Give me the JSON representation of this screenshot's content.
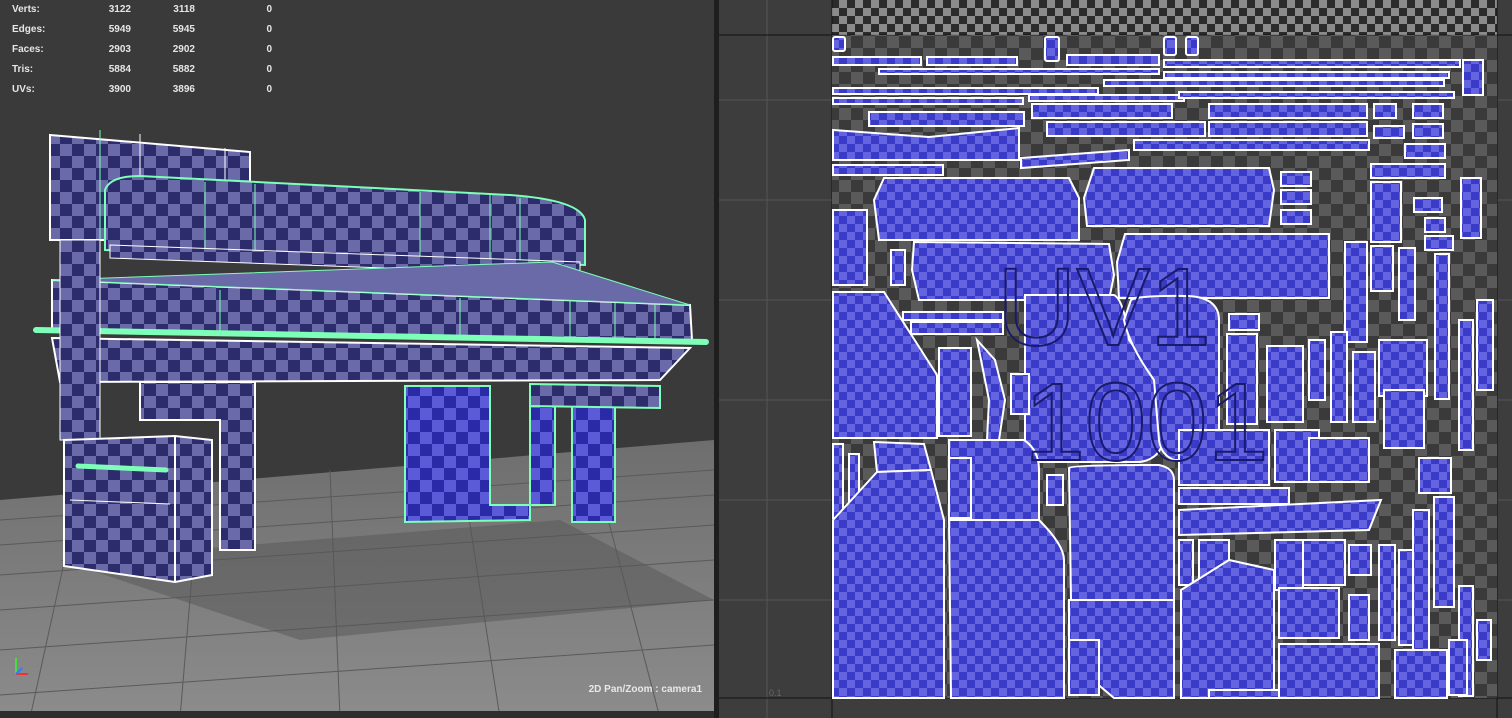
{
  "hud": {
    "rows": [
      {
        "label": "Verts:",
        "v1": "3122",
        "v2": "3118",
        "v3": "0"
      },
      {
        "label": "Edges:",
        "v1": "5949",
        "v2": "5945",
        "v3": "0"
      },
      {
        "label": "Faces:",
        "v1": "2903",
        "v2": "2902",
        "v3": "0"
      },
      {
        "label": "Tris:",
        "v1": "5884",
        "v2": "5882",
        "v3": "0"
      },
      {
        "label": "UVs:",
        "v1": "3900",
        "v2": "3896",
        "v3": "0"
      }
    ]
  },
  "viewport": {
    "camera_label": "2D Pan/Zoom : camera1"
  },
  "uv_editor": {
    "tile_label_top": "UV1",
    "tile_label_bottom": "1001",
    "coord_label": "0.1"
  },
  "colors": {
    "uv_shell": "#3a3ad0",
    "wireframe_selected": "#7dffb8",
    "border": "#ffffff"
  }
}
